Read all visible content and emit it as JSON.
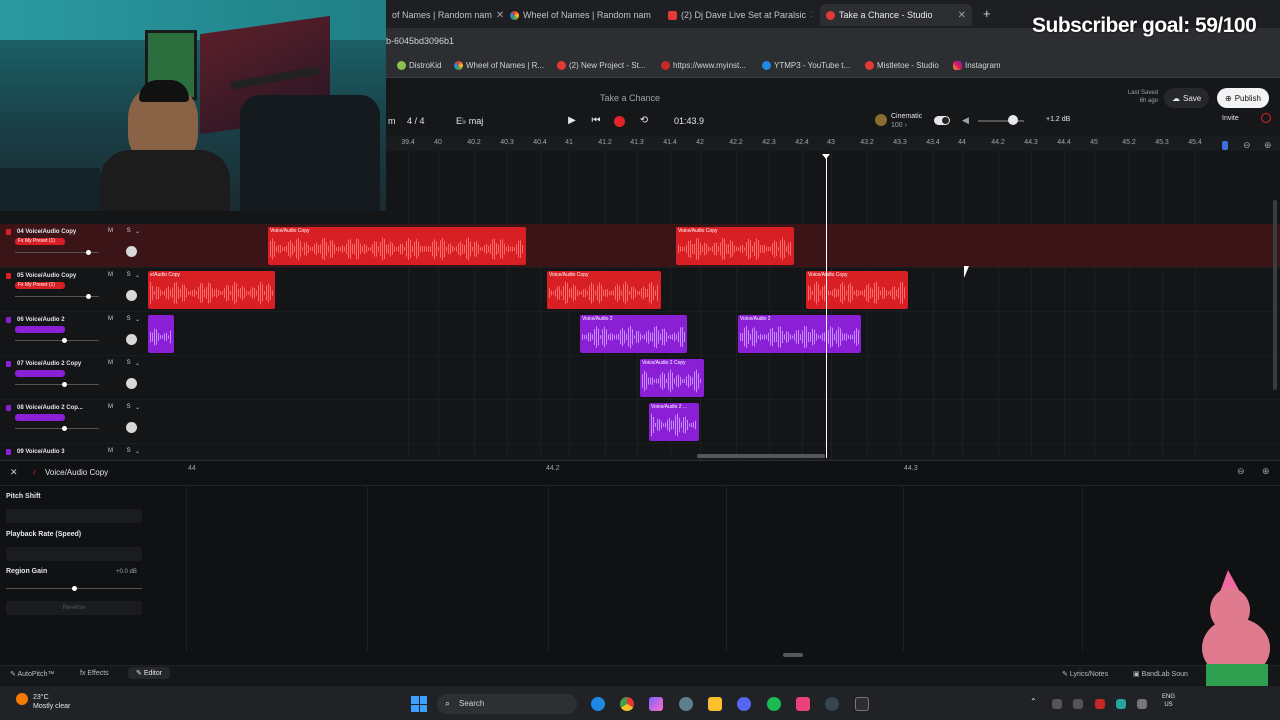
{
  "browser": {
    "tabs": [
      {
        "label": "of Names | Random nam"
      },
      {
        "label": "Wheel of Names | Random nam"
      },
      {
        "label": "(2) Dj Dave Live Set at Paralsic"
      },
      {
        "label": "Take a Chance - Studio"
      }
    ],
    "url": "b-6045bd3096b1",
    "bookmarks": [
      "DistroKid",
      "Wheel of Names | R...",
      "(2) New Project - St...",
      "https://www.myinst...",
      "YTMP3 - YouTube t...",
      "Mistletoe - Studio",
      "Instagram"
    ]
  },
  "overlay": {
    "subscriber_goal": "Subscriber goal: 59/100"
  },
  "header": {
    "song_title": "Take a Chance",
    "time_signature": "4 / 4",
    "key": "E♭ maj",
    "tempo_fragment": "m",
    "clock": "01:43.9",
    "cinematic_label": "Cinematic",
    "cinematic_sub": "100 ›",
    "gain": "+1.2 dB",
    "last_saved_label": "Last Saved",
    "last_saved_time": "6h ago",
    "save_label": "Save",
    "publish_label": "Publish",
    "invite_label": "Invite"
  },
  "ruler": {
    "ticks": [
      "39.4",
      "40",
      "40.2",
      "40.3",
      "40.4",
      "41",
      "41.2",
      "41.3",
      "41.4",
      "42",
      "42.2",
      "42.3",
      "42.4",
      "43",
      "43.2",
      "43.3",
      "43.4",
      "44",
      "44.2",
      "44.3",
      "44.4",
      "45",
      "45.2",
      "45.3",
      "45.4"
    ]
  },
  "tracks": [
    {
      "num": "04",
      "name": "Voice/Audio Copy",
      "preset": "Fx My Preset (1)",
      "ms": "M S",
      "color": "#d81f24",
      "selected": true,
      "clips": [
        {
          "name": "Voice/Audio Copy"
        },
        {
          "name": "Voice/Audio Copy"
        }
      ]
    },
    {
      "num": "05",
      "name": "Voice/Audio Copy",
      "preset": "Fx My Preset (1)",
      "ms": "M S",
      "color": "#d81f24",
      "selected": false,
      "clips": [
        {
          "name": "e/Audio Copy"
        },
        {
          "name": "Voice/Audio Copy"
        },
        {
          "name": "Voice/Audio Copy"
        }
      ]
    },
    {
      "num": "06",
      "name": "Voice/Audio 2",
      "preset": "",
      "ms": "M S",
      "color": "#8a1fd6",
      "selected": false,
      "clips": [
        {
          "name": ""
        },
        {
          "name": "Voice/Audio 2"
        },
        {
          "name": "Voice/Audio 2"
        }
      ]
    },
    {
      "num": "07",
      "name": "Voice/Audio 2 Copy",
      "preset": "",
      "ms": "M S",
      "color": "#8a1fd6",
      "selected": false,
      "clips": [
        {
          "name": "Voice/Audio 2 Copy"
        }
      ]
    },
    {
      "num": "08",
      "name": "Voice/Audio 2 Cop...",
      "preset": "",
      "ms": "M S",
      "color": "#8a1fd6",
      "selected": false,
      "clips": [
        {
          "name": "Voice/Audio 2 ..."
        }
      ]
    },
    {
      "num": "09",
      "name": "Voice/Audio 3",
      "preset": "",
      "ms": "M S",
      "color": "#8a1fd6",
      "selected": false,
      "clips": []
    }
  ],
  "editor": {
    "title": "Voice/Audio Copy",
    "ticks": [
      "44",
      "44.2",
      "44.3"
    ],
    "pitch_shift_label": "Pitch Shift",
    "playback_rate_label": "Playback Rate (Speed)",
    "region_gain_label": "Region Gain",
    "region_gain_value": "+0.0 dB",
    "reverse_label": "Reverse"
  },
  "bottombar": {
    "autopitch": "AutoPitch™",
    "effects": "Effects",
    "editor": "Editor",
    "lyrics": "Lyrics/Notes",
    "bandlab": "BandLab Soun"
  },
  "taskbar": {
    "temperature": "23°C",
    "weather": "Mostly clear",
    "search": "Search",
    "lang_top": "ENG",
    "lang_bottom": "US"
  },
  "colors": {
    "accent_red": "#d81f24",
    "accent_purple": "#8a1fd6",
    "record": "#e0242a"
  }
}
